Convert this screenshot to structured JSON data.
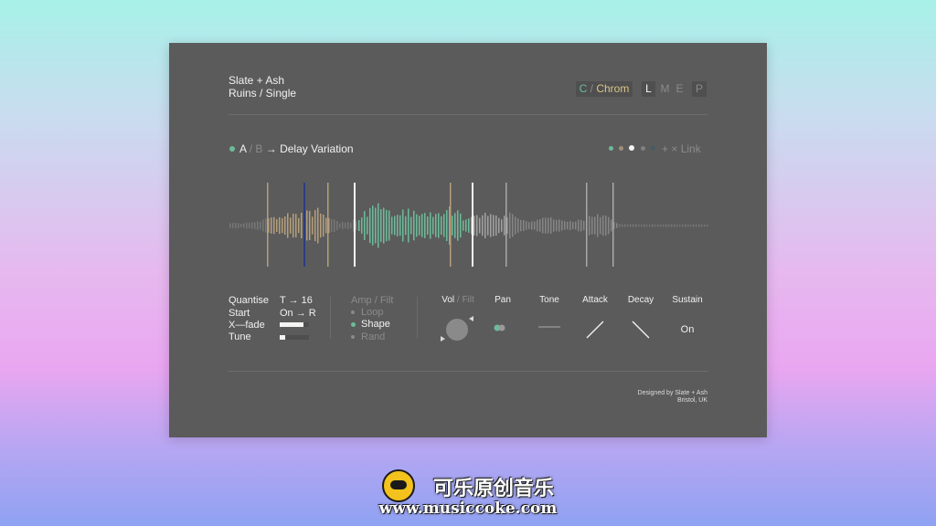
{
  "header": {
    "brand": "Slate + Ash",
    "product": "Ruins / Single"
  },
  "presets": {
    "key": "C",
    "separator": "/",
    "scale": "Chrom",
    "modes": [
      "L",
      "M",
      "E",
      "P"
    ],
    "active_mode": "L"
  },
  "layer": {
    "a": "A",
    "separator": "/",
    "b": "B",
    "arrow": "→",
    "name": "Delay Variation"
  },
  "link": {
    "plus": "+",
    "cross": "×",
    "label": "Link"
  },
  "params": {
    "quantise": {
      "label": "Quantise",
      "value": "T → 16"
    },
    "start": {
      "label": "Start",
      "value": "On → R"
    },
    "xfade": {
      "label": "X—fade",
      "level": 0.8
    },
    "tune": {
      "label": "Tune",
      "level": 0.18
    }
  },
  "mod": {
    "title_a": "Amp",
    "separator": "/",
    "title_b": "Filt",
    "options": [
      "Loop",
      "Shape",
      "Rand"
    ],
    "selected": "Shape"
  },
  "controls": {
    "vol": "Vol",
    "separator": "/",
    "filt": "Filt",
    "pan": "Pan",
    "tone": "Tone",
    "attack": "Attack",
    "decay": "Decay",
    "sustain": "Sustain",
    "sustain_value": "On"
  },
  "credits": {
    "line1": "Designed by Slate + Ash",
    "line2": "Bristol, UK"
  },
  "watermark": {
    "title": "可乐原创音乐",
    "url": "www.musiccoke.com"
  },
  "colors": {
    "accent_green": "#6dbb98",
    "accent_tan": "#b59f7a",
    "accent_yellow": "#dcc586",
    "marker_blue": "#2c3d82"
  }
}
